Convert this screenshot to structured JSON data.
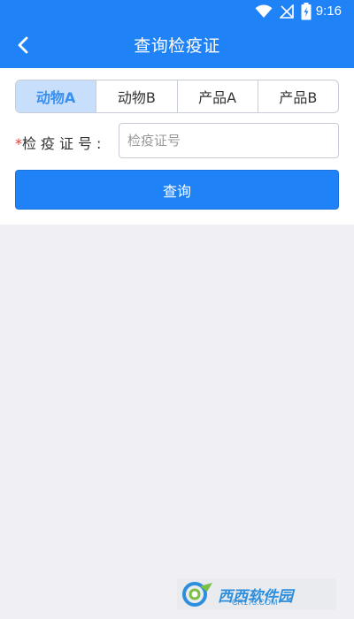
{
  "status_bar": {
    "time": "9:16",
    "icons": [
      "wifi-icon",
      "no-signal-icon",
      "battery-charging-icon"
    ]
  },
  "header": {
    "back_icon": "chevron-left-icon",
    "title": "查询检疫证"
  },
  "tabs": [
    {
      "label": "动物A",
      "active": true
    },
    {
      "label": "动物B",
      "active": false
    },
    {
      "label": "产品A",
      "active": false
    },
    {
      "label": "产品B",
      "active": false
    }
  ],
  "form": {
    "required_mark": "*",
    "cert_label": "检疫证号:",
    "cert_placeholder": "检疫证号",
    "cert_value": ""
  },
  "actions": {
    "query_label": "查询"
  },
  "watermark": {
    "text": "西西软件园",
    "url": "CR173.COM"
  },
  "colors": {
    "primary": "#1f82f6",
    "tab_active_bg": "#c7dffb",
    "tab_active_text": "#3a8fef",
    "page_bg": "#efeff4",
    "required": "#e53935"
  }
}
